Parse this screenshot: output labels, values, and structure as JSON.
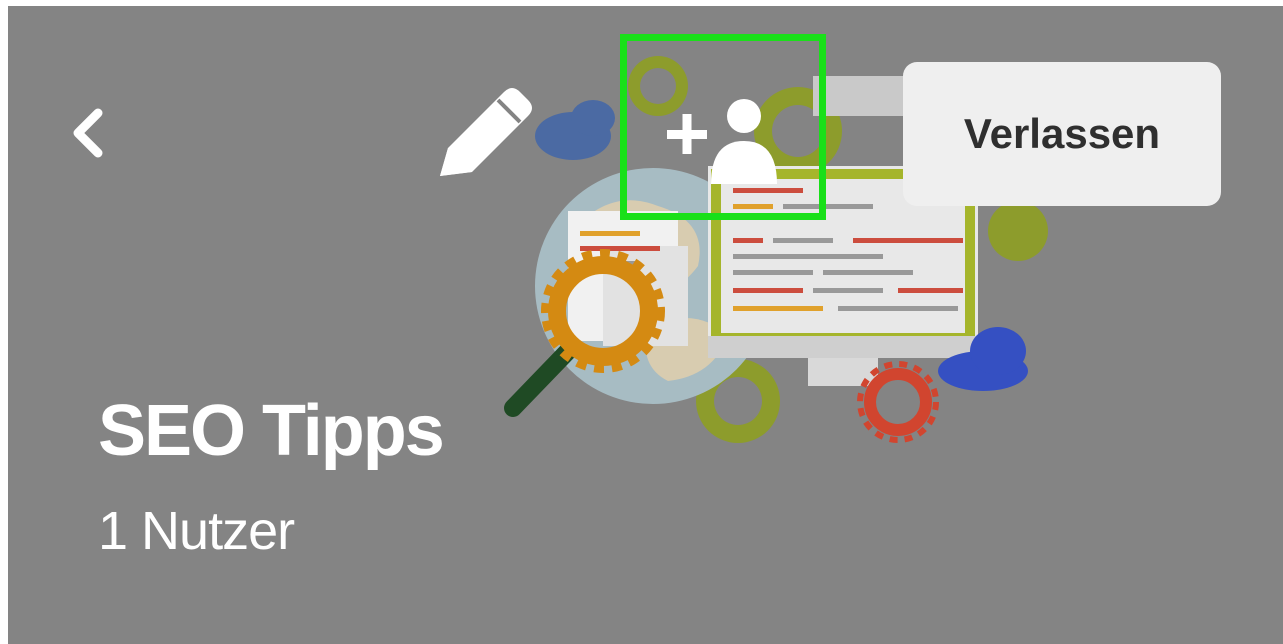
{
  "header": {
    "back_icon": "chevron-left-icon",
    "edit_icon": "pencil-icon",
    "add_user_icon": "add-user-icon",
    "leave_label": "Verlassen"
  },
  "group": {
    "title": "SEO Tipps",
    "member_count": "1 Nutzer"
  },
  "colors": {
    "background": "#848484",
    "highlight": "#19e019",
    "leave_button_bg": "#efefef",
    "text": "#ffffff"
  }
}
